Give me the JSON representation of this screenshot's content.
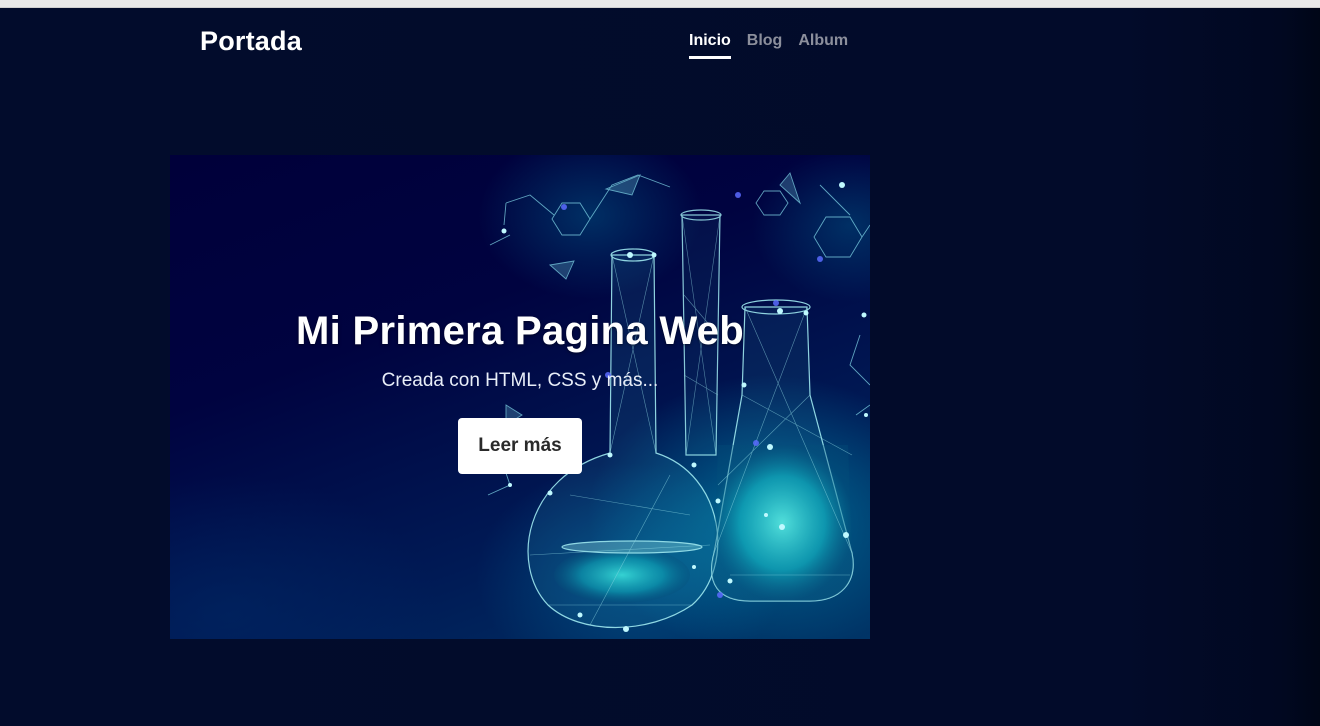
{
  "header": {
    "brand": "Portada",
    "nav": [
      {
        "label": "Inicio",
        "active": true
      },
      {
        "label": "Blog",
        "active": false
      },
      {
        "label": "Album",
        "active": false
      }
    ]
  },
  "hero": {
    "title": "Mi Primera Pagina Web",
    "subtitle": "Creada con HTML, CSS y más...",
    "button_label": "Leer más",
    "image": "lab-flasks-polygon-illustration"
  },
  "colors": {
    "background": "#020b2a",
    "accent_glow": "#3ee8e0",
    "nav_active": "#ffffff",
    "nav_inactive": "#8c8f9c"
  }
}
